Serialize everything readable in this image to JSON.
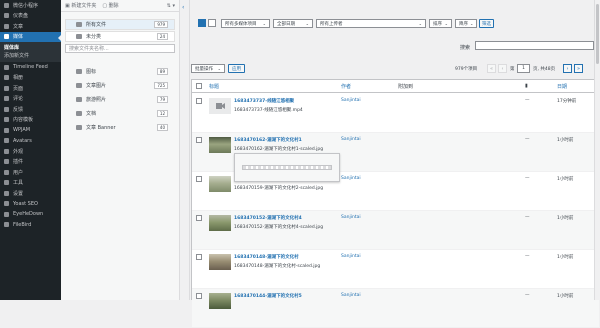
{
  "sidebar": {
    "items": [
      {
        "label": "微信小程序",
        "key": "wechat"
      },
      {
        "label": "仪表盘",
        "key": "dashboard"
      },
      {
        "label": "文章",
        "key": "posts"
      },
      {
        "label": "媒体",
        "key": "media",
        "active": true
      },
      {
        "label": "Timeline Feed",
        "key": "timeline"
      },
      {
        "label": "相册",
        "key": "albums"
      },
      {
        "label": "页面",
        "key": "pages"
      },
      {
        "label": "评论",
        "key": "comments"
      },
      {
        "label": "反馈",
        "key": "feedback"
      },
      {
        "label": "内容模板",
        "key": "templates"
      },
      {
        "label": "WPJAM",
        "key": "wpjam"
      },
      {
        "label": "Avatars",
        "key": "avatars"
      },
      {
        "label": "外观",
        "key": "appearance"
      },
      {
        "label": "插件",
        "key": "plugins"
      },
      {
        "label": "用户",
        "key": "users"
      },
      {
        "label": "工具",
        "key": "tools"
      },
      {
        "label": "设置",
        "key": "settings"
      },
      {
        "label": "Yoast SEO",
        "key": "yoast"
      },
      {
        "label": "EyeHeDown",
        "key": "eyehedown"
      },
      {
        "label": "FileBird",
        "key": "filebird"
      }
    ],
    "media_sub": [
      "媒体库",
      "添加新文件"
    ]
  },
  "folders": {
    "toolbar": {
      "new_folder": "新建文件夹",
      "delete": "删除"
    },
    "all_files": {
      "label": "所有文件",
      "count": "979"
    },
    "uncategorized": {
      "label": "未分类",
      "count": "24"
    },
    "search_placeholder": "搜索文件夹名称...",
    "list": [
      {
        "label": "图标",
        "count": "89"
      },
      {
        "label": "文章图片",
        "count": "725"
      },
      {
        "label": "旅游照片",
        "count": "79"
      },
      {
        "label": "文档",
        "count": "12"
      },
      {
        "label": "文章 Banner",
        "count": "40"
      }
    ]
  },
  "filters": {
    "media_types": "所有多媒体项目",
    "dates": "全部日期",
    "uploaders": "所有上传者",
    "sort": "排序",
    "order": "降序",
    "filter_btn": "筛选"
  },
  "search": {
    "label": "搜索"
  },
  "bulk": {
    "action": "批量操作",
    "apply": "应用"
  },
  "pagination": {
    "count": "979个项目",
    "current": "1",
    "of": "页, 共48页",
    "first": "«",
    "prev": "‹",
    "next": "›",
    "last": "»"
  },
  "table": {
    "headers": {
      "title": "标题",
      "author": "作者",
      "attached": "附加到",
      "comments_icon": "comment-icon",
      "date": "日期"
    },
    "rows": [
      {
        "title": "1683473737-线随江悠相聚",
        "file": "1683473737-线随江悠相聚.mp4",
        "author": "Sanjintai",
        "dash": "—",
        "date": "17分钟前",
        "kind": "video"
      },
      {
        "title": "1683470162-湄湖下的文化村1",
        "file": "1683470162-湄湖下的文化村1-scaled.jpg",
        "author": "Sanjintai",
        "dash": "—",
        "date": "1小时前",
        "kind": "photo"
      },
      {
        "title": "1683470159-湄湖下的文化村2",
        "file": "1683470159-湄湖下的文化村2-scaled.jpg",
        "author": "Sanjintai",
        "dash": "—",
        "date": "1小时前",
        "kind": "photo"
      },
      {
        "title": "1683470152-湄湖下的文化村4",
        "file": "1683470152-湄湖下的文化村4-scaled.jpg",
        "author": "Sanjintai",
        "dash": "—",
        "date": "1小时前",
        "kind": "photo"
      },
      {
        "title": "1683470148-湄湖下的文化村",
        "file": "1683470148-湄湖下的文化村-scaled.jpg",
        "author": "Sanjintai",
        "dash": "—",
        "date": "1小时前",
        "kind": "photo"
      },
      {
        "title": "1683470144-湄湖下的文化村5",
        "file": "",
        "author": "Sanjintai",
        "dash": "—",
        "date": "1小时前",
        "kind": "photo"
      }
    ]
  },
  "colors": {
    "accent": "#2271b1",
    "sidebar_bg": "#1d2327"
  }
}
